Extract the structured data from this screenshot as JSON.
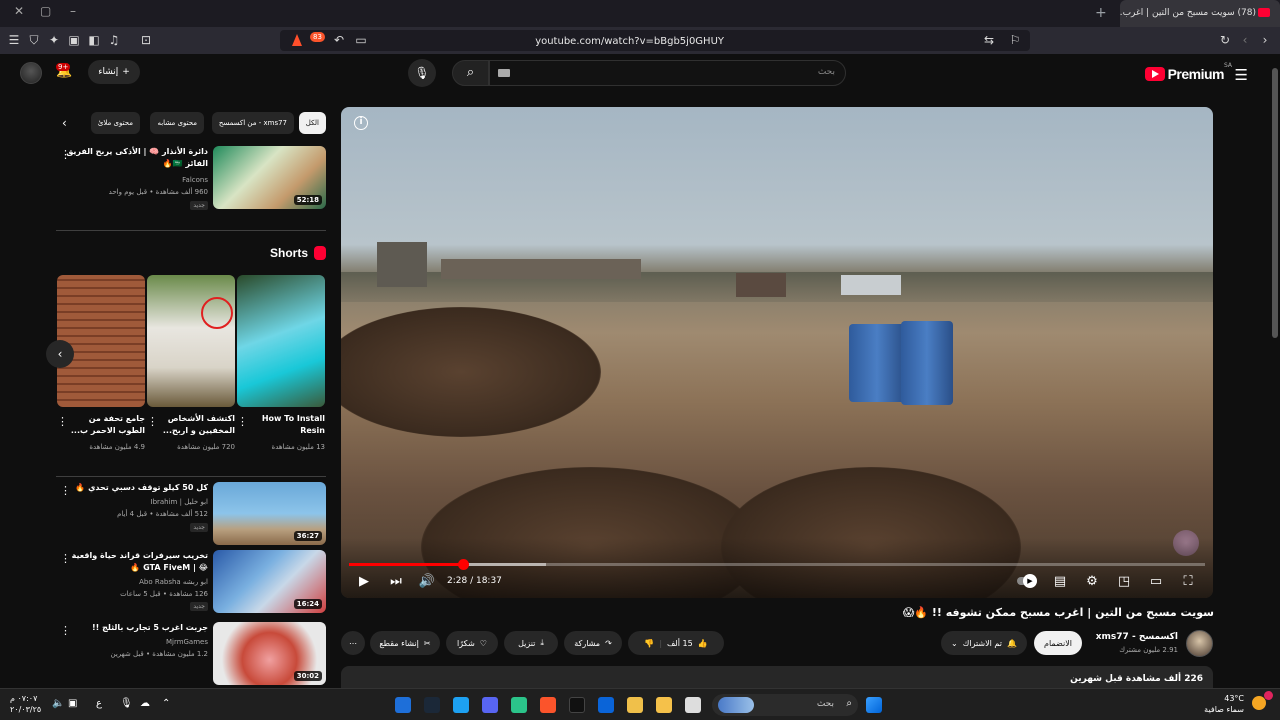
{
  "browser": {
    "tab_title": "(78) سويت مسبح من التين | اغرب…",
    "url": "youtube.com/watch?v=bBgb5j0GHUY",
    "shields_count": "83"
  },
  "header": {
    "logo_text": "Premium",
    "country": "SA",
    "search_placeholder": "بحث",
    "create_label": "إنشاء",
    "notifications": "9+"
  },
  "player": {
    "time": "2:28 / 18:37",
    "progress_fraction": 0.133,
    "buffer_fraction": 0.23,
    "info_icon": "i"
  },
  "video": {
    "title": "سويت مسبح من التين | اغرب مسبح ممكن تشوفه !! 🔥😱",
    "channel": "اكسمسح - xms77",
    "subscribers": "2.91 مليون مشترك",
    "join_label": "الانضمام",
    "subscribed_label": "تم الاشتراك",
    "likes": "15 ألف",
    "share_label": "مشاركة",
    "download_label": "تنزيل",
    "thanks_label": "شكرًا",
    "clip_label": "إنشاء مقطع",
    "description_stats": "226 ألف مشاهدة  قبل شهرين"
  },
  "chips": {
    "all": "الكل",
    "from_channel": "من اكسمسح - xms77",
    "similar": "محتوى مشابه",
    "related": "محتوى ملائ"
  },
  "recommendations": [
    {
      "title": "دائرة الأنذار 🧠 | الأذكى يربح الفريق الفائز 🇸🇦🔥",
      "channel": "Falcons",
      "meta": "960 ألف مشاهدة • قبل يوم واحد",
      "badge": "جديد",
      "duration": "52:18"
    },
    {
      "title": "كل 50 كيلو توقف دسبي تحدي 🔥",
      "channel": "ابو خليل | Ibrahim",
      "meta": "512 ألف مشاهدة • قبل 4 أيام",
      "badge": "جديد",
      "duration": "36:27"
    },
    {
      "title": "تخريب سيرفرات قراند حياة واقعية 😂 | GTA FiveM 🔥",
      "channel": "ابو ربشه Abo Rabsha",
      "meta": "126 مشاهدة • قبل 5 ساعات",
      "badge": "جديد",
      "duration": "16:24"
    },
    {
      "title": "جربت اغرب 5 تجارب بالثلج !!",
      "channel": "MjrmGames",
      "meta": "1.2 مليون مشاهدة • قبل شهرين",
      "badge": "",
      "duration": "30:02"
    }
  ],
  "shorts": {
    "heading": "Shorts",
    "items": [
      {
        "title": "How To Install Resin",
        "views": "13 مليون مشاهدة"
      },
      {
        "title": "اكتشف الأشخاص المخفيين و اربح...",
        "views": "720 مليون مشاهدة"
      },
      {
        "title": "جامع تحفة من الطوب الاحمر ب...",
        "views": "4.9 مليون مشاهدة"
      }
    ]
  },
  "taskbar": {
    "search_label": "بحث",
    "time": "٠٧:٠٧ م",
    "date": "٢٠/٠٣/٢٥",
    "temperature": "43°C",
    "weather": "سماء صافية",
    "lang": "ع"
  }
}
